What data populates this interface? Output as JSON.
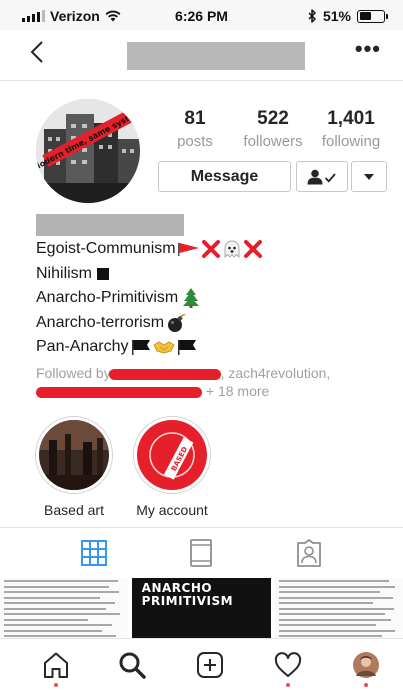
{
  "status_bar": {
    "carrier": "Verizon",
    "time": "6:26 PM",
    "battery": "51%",
    "battery_level": 0.51
  },
  "nav": {
    "back_icon": "chevron-left-icon",
    "more_label": "•••"
  },
  "profile": {
    "stats": [
      {
        "count": "81",
        "label": "posts"
      },
      {
        "count": "522",
        "label": "followers"
      },
      {
        "count": "1,401",
        "label": "following"
      }
    ],
    "message_label": "Message",
    "avatar_text": "Modern time, same system."
  },
  "bio": [
    "Egoist-Communism",
    "Nihilism",
    "Anarcho-Primitivism",
    "Anarcho-terrorism",
    "Pan-Anarchy"
  ],
  "followed_by": {
    "prefix": "Followed by",
    "name": ", zach4revolution,",
    "more": "+ 18 more"
  },
  "highlights": [
    {
      "label": "Based art"
    },
    {
      "label": "My account"
    }
  ],
  "account_highlight_text": "BASED",
  "poster_text": "ANARCHO PRIMITIVISM",
  "colors": {
    "accent_red": "#e5202a",
    "notification": "#ed4956",
    "tab_active": "#3897f0"
  }
}
